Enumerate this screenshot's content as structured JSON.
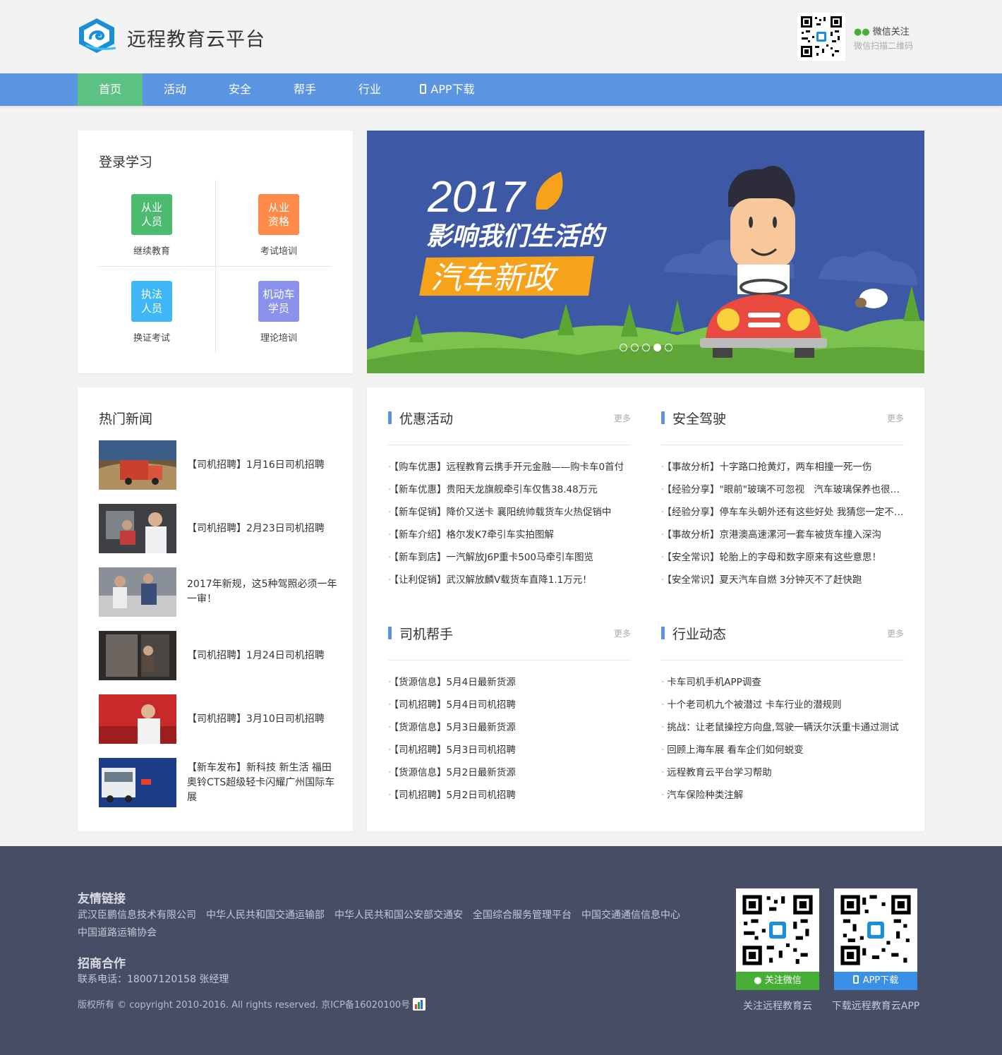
{
  "header": {
    "site_title": "远程教育云平台",
    "wechat_follow": "微信关注",
    "wechat_scan": "微信扫描二维码"
  },
  "nav": {
    "items": [
      "首页",
      "活动",
      "安全",
      "帮手",
      "行业"
    ],
    "app_label": "APP下载"
  },
  "login": {
    "title": "登录学习",
    "tiles": [
      {
        "line1": "从业",
        "line2": "人员",
        "caption": "继续教育",
        "color": "#4cbb6e"
      },
      {
        "line1": "从业",
        "line2": "资格",
        "caption": "考试培训",
        "color": "#ff8a4a"
      },
      {
        "line1": "执法",
        "line2": "人员",
        "caption": "换证考试",
        "color": "#3fb6f5"
      },
      {
        "line1": "机动车",
        "line2": "学员",
        "caption": "理论培训",
        "color": "#8a92ee"
      }
    ]
  },
  "banner": {
    "year": "2017",
    "line1": "影响我们生活的",
    "line2": "汽车新政",
    "active_dot": 3,
    "dot_count": 5
  },
  "hot_news": {
    "title": "热门新闻",
    "items": [
      "【司机招聘】1月16日司机招聘",
      "【司机招聘】2月23日司机招聘",
      "2017年新规，这5种驾照必须一年一审！",
      "【司机招聘】1月24日司机招聘",
      "【司机招聘】3月10日司机招聘",
      "【新车发布】新科技 新生活 福田奥铃CTS超级轻卡闪耀广州国际车展"
    ]
  },
  "blocks": {
    "more": "更多",
    "promo": {
      "title": "优惠活动",
      "items": [
        "【购车优惠】远程教育云携手开元金融——购卡车0首付",
        "【新车优惠】贵阳天龙旗舰牵引车仅售38.48万元",
        "【新车促销】降价又送卡 襄阳统帅载货车火热促销中",
        "【新车介绍】格尔发K7牵引车实拍图解",
        "【新车到店】一汽解放J6P重卡500马牵引车图览",
        "【让利促销】武汉解放麟V载货车直降1.1万元！"
      ]
    },
    "safety": {
      "title": "安全驾驶",
      "items": [
        "【事故分析】十字路口抢黄灯，两车相撞一死一伤",
        "【经验分享】\"眼前\"玻璃不可忽视　汽车玻璃保养也很重要",
        "【经验分享】停车车头朝外还有这些好处 我猜您一定不知道",
        "【事故分析】京港澳高速漯河一套车被货车撞入深沟",
        "【安全常识】轮胎上的字母和数字原来有这些意思！",
        "【安全常识】夏天汽车自燃 3分钟灭不了赶快跑"
      ]
    },
    "helper": {
      "title": "司机帮手",
      "items": [
        "【货源信息】5月4日最新货源",
        "【司机招聘】5月4日司机招聘",
        "【货源信息】5月3日最新货源",
        "【司机招聘】5月3日司机招聘",
        "【货源信息】5月2日最新货源",
        "【司机招聘】5月2日司机招聘"
      ]
    },
    "industry": {
      "title": "行业动态",
      "items": [
        "卡车司机手机APP调查",
        "十个老司机九个被潜过 卡车行业的潜规则",
        "挑战：让老鼠操控方向盘,驾驶一辆沃尔沃重卡通过测试",
        "回顾上海车展 看车企们如何蜕变",
        "远程教育云平台学习帮助",
        "汽车保险种类注解"
      ]
    }
  },
  "footer": {
    "links_title": "友情链接",
    "links": [
      "武汉臣鹏信息技术有限公司",
      "中华人民共和国交通运输部",
      "中华人民共和国公安部交通安",
      "全国综合服务管理平台",
      "中国交通通信信息中心",
      "中国道路运输协会"
    ],
    "biz_title": "招商合作",
    "phone": "联系电话：18007120158 张经理",
    "copyright": "版权所有 © copyright 2010-2016. All rights reserved. 京ICP备16020100号",
    "wechat_btn": "关注微信",
    "app_btn": "APP下载",
    "wechat_caption": "关注远程教育云",
    "app_caption": "下载远程教育云APP",
    "wechat_color": "#45b035",
    "app_color": "#3a8fe6"
  }
}
